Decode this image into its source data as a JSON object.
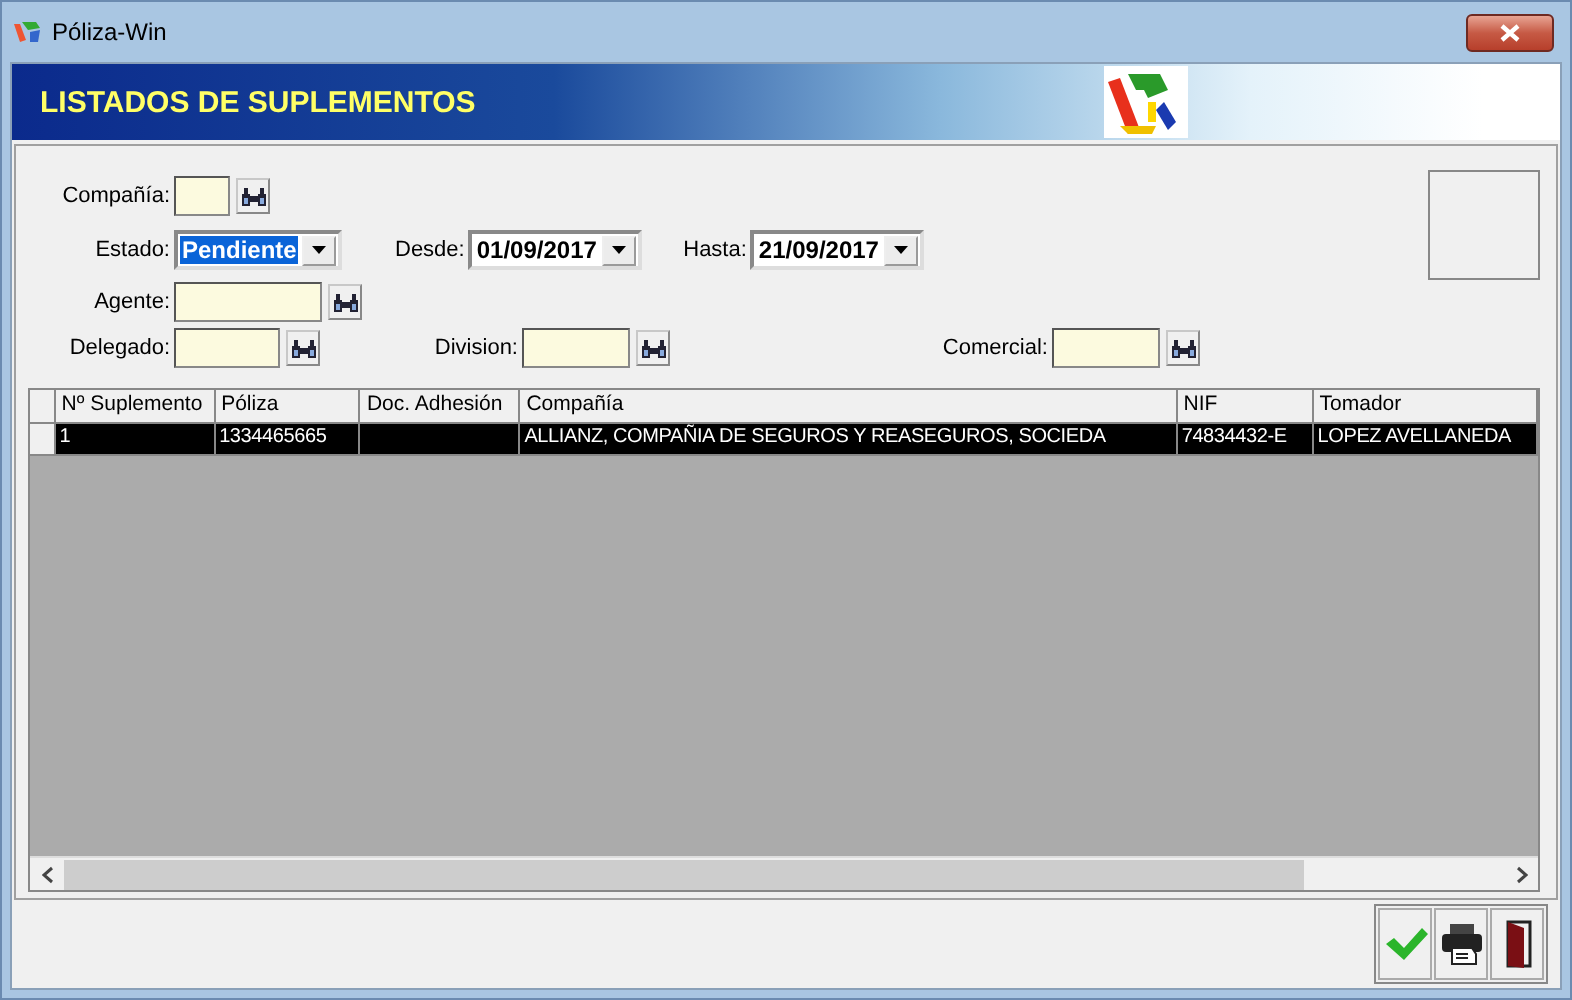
{
  "window": {
    "title": "Póliza-Win"
  },
  "header": {
    "title": "LISTADOS DE SUPLEMENTOS"
  },
  "filters": [
    {
      "label": "Compañía:",
      "kind": "lookup"
    },
    {
      "label": "Estado:",
      "kind": "combo",
      "value": "Pendiente",
      "focused": true
    },
    {
      "label": "Desde:",
      "kind": "combo",
      "value": "01/09/2017",
      "focused": false
    },
    {
      "label": "Hasta:",
      "kind": "combo",
      "value": "21/09/2017",
      "focused": false
    },
    {
      "label": "Agente:",
      "kind": "lookup"
    },
    {
      "label": "Delegado:",
      "kind": "lookup"
    },
    {
      "label": "Division:",
      "kind": "lookup"
    },
    {
      "label": "Comercial:",
      "kind": "lookup"
    }
  ],
  "table": {
    "columns": [
      "Nº Suplemento",
      "Póliza",
      "Doc. Adhesión",
      "Compañía",
      "NIF",
      "Tomador"
    ],
    "rows": [
      {
        "selected": true,
        "cells": [
          "1",
          "1334465665",
          "",
          "ALLIANZ, COMPAÑIA DE SEGUROS Y REASEGUROS, SOCIEDA",
          "74834432-E",
          "LOPEZ AVELLANEDA"
        ]
      }
    ]
  }
}
